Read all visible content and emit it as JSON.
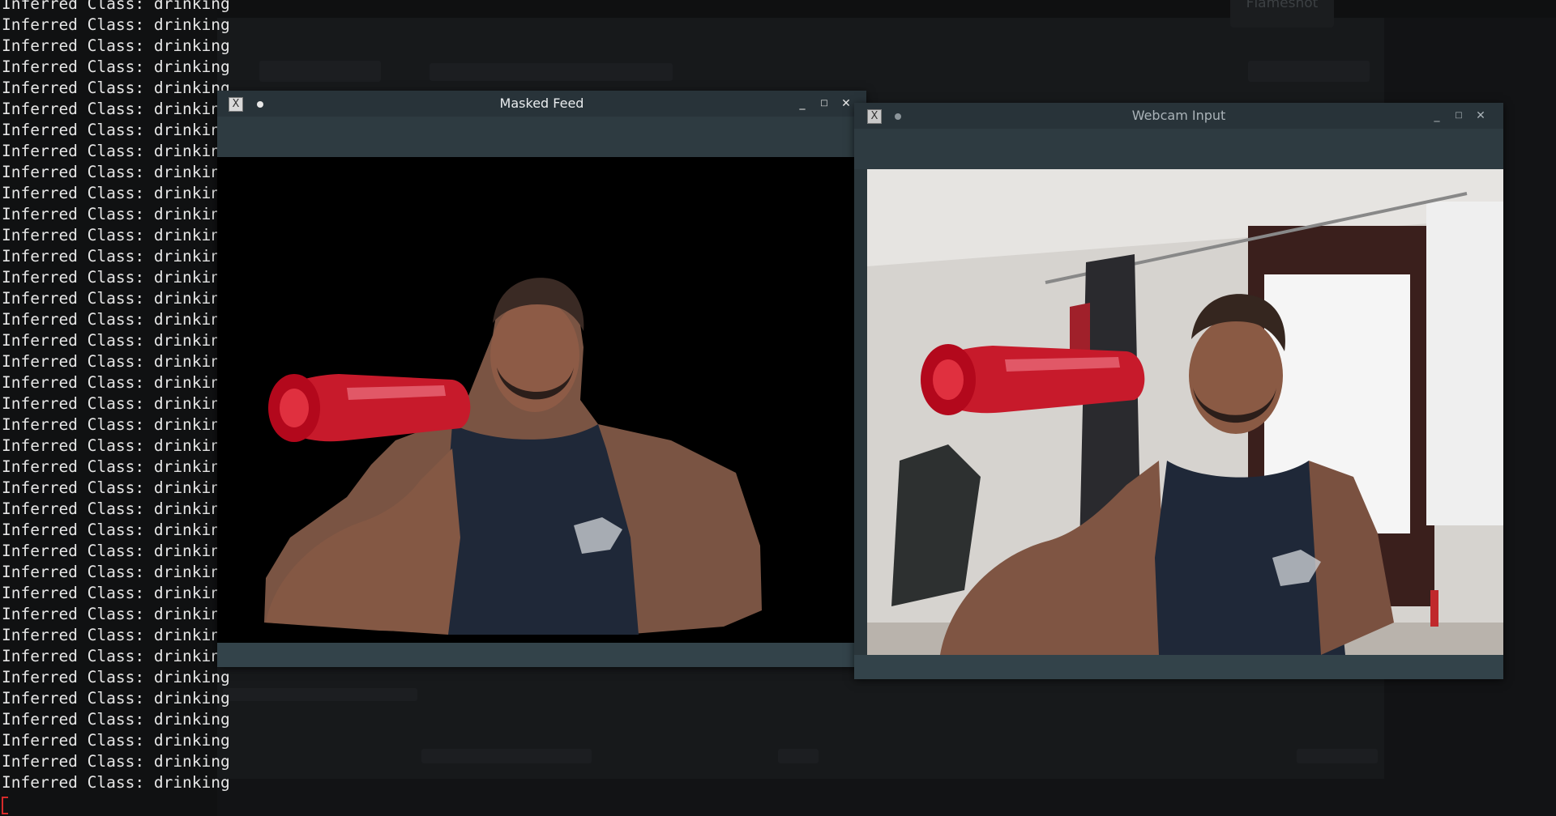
{
  "terminal": {
    "lines": [
      "Inferred Class: drinking",
      "Inferred Class: drinking",
      "Inferred Class: drinking",
      "Inferred Class: drinking",
      "Inferred Class: drinking",
      "Inferred Class: drinking",
      "Inferred Class: drinking",
      "Inferred Class: drinking",
      "Inferred Class: drinking",
      "Inferred Class: drinking",
      "Inferred Class: drinking",
      "Inferred Class: drinking",
      "Inferred Class: drinking",
      "Inferred Class: drinking",
      "Inferred Class: drinking",
      "Inferred Class: drinking",
      "Inferred Class: drinking",
      "Inferred Class: drinking",
      "Inferred Class: drinking",
      "Inferred Class: drinking",
      "Inferred Class: drinking",
      "Inferred Class: drinking",
      "Inferred Class: drinking",
      "Inferred Class: drinking",
      "Inferred Class: drinking",
      "Inferred Class: drinking",
      "Inferred Class: drinking",
      "Inferred Class: drinking",
      "Inferred Class: drinking",
      "Inferred Class: drinking",
      "Inferred Class: drinking",
      "Inferred Class: drinking",
      "Inferred Class: drinking",
      "Inferred Class: drinking",
      "Inferred Class: drinking",
      "Inferred Class: drinking",
      "Inferred Class: drinking",
      "Inferred Class: drinking"
    ]
  },
  "background": {
    "toast_label": "Flameshot"
  },
  "windows": {
    "masked": {
      "title": "Masked Feed",
      "minimize_glyph": "_",
      "maximize_glyph": "□",
      "close_glyph": "✕",
      "app_icon": "x-window-icon"
    },
    "webcam": {
      "title": "Webcam Input",
      "minimize_glyph": "_",
      "maximize_glyph": "□",
      "close_glyph": "✕",
      "app_icon": "x-window-icon"
    }
  },
  "colors": {
    "bottle_red": "#d11a2c",
    "shirt_navy": "#1f2838",
    "skin": "#8a5a44",
    "wall": "#d9d7d4",
    "window_bright": "#f4f4f4",
    "frame_dark": "#3a1f1c"
  }
}
